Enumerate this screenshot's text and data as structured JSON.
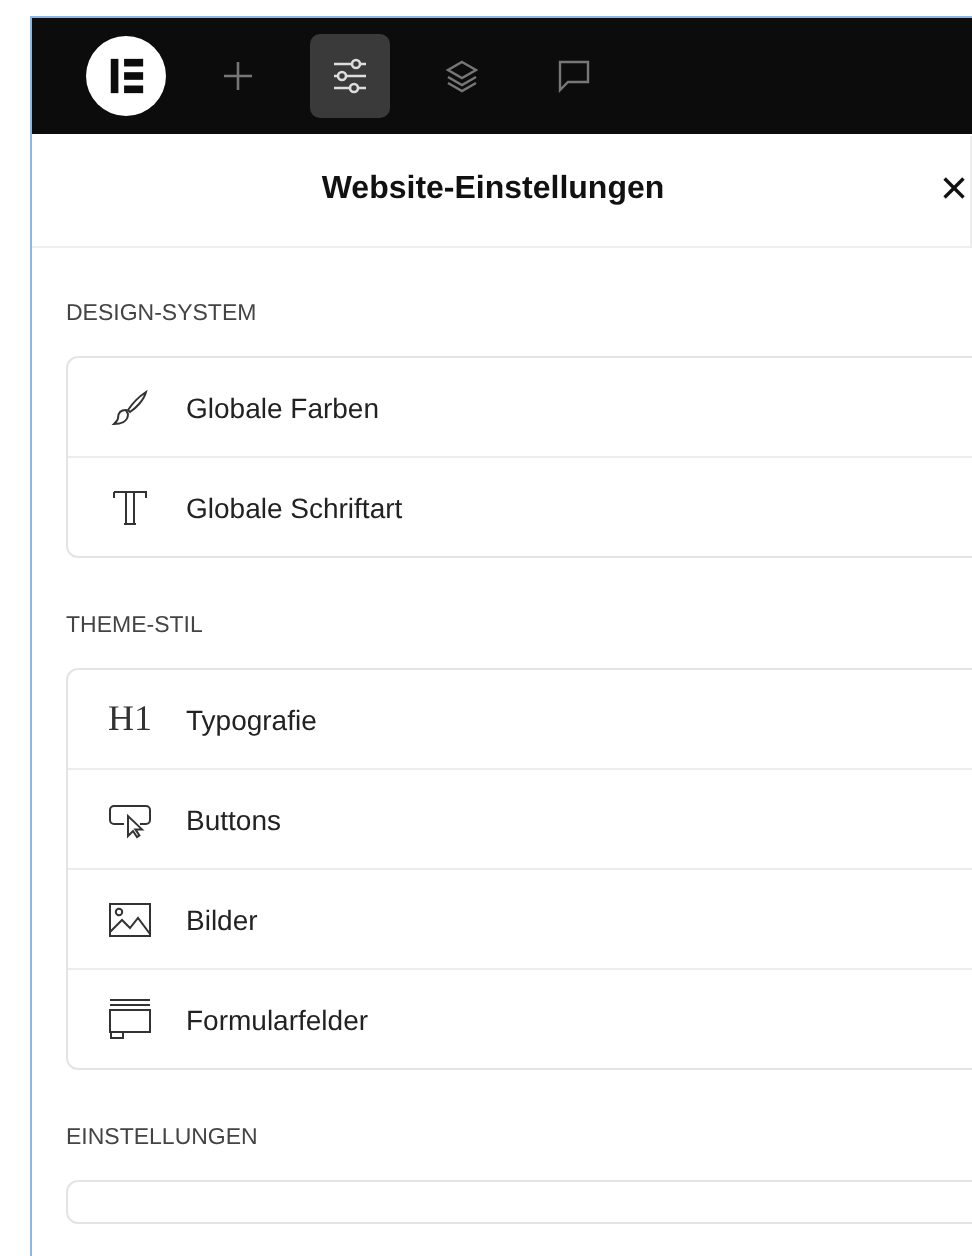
{
  "toolbar": [
    {
      "kind": "logo",
      "selected": false
    },
    {
      "kind": "add",
      "selected": false
    },
    {
      "kind": "settings",
      "selected": true
    },
    {
      "kind": "layers",
      "selected": false
    },
    {
      "kind": "comments",
      "selected": false
    }
  ],
  "panel": {
    "title": "Website-Einstellungen",
    "close": "×"
  },
  "sections": [
    {
      "heading": "DESIGN-SYSTEM",
      "items": [
        {
          "kind": "brush",
          "label": "Globale Farben"
        },
        {
          "kind": "font",
          "label": "Globale Schriftart"
        }
      ]
    },
    {
      "heading": "THEME-STIL",
      "items": [
        {
          "kind": "heading",
          "icon_text": "H1",
          "label": "Typografie"
        },
        {
          "kind": "button",
          "label": "Buttons"
        },
        {
          "kind": "image",
          "label": "Bilder"
        },
        {
          "kind": "form",
          "label": "Formularfelder"
        }
      ]
    },
    {
      "heading": "EINSTELLUNGEN"
    }
  ]
}
